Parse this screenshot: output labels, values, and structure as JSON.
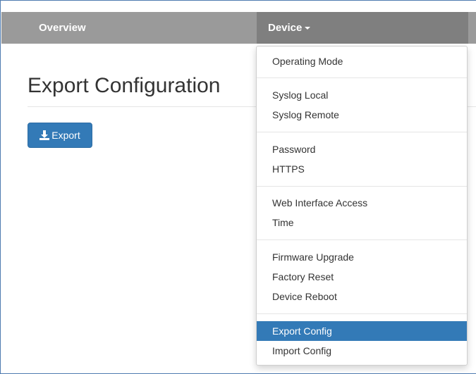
{
  "navbar": {
    "overview_label": "Overview",
    "device_label": "Device"
  },
  "page": {
    "title": "Export Configuration",
    "export_button_label": "Export"
  },
  "device_menu": {
    "items": [
      {
        "label": "Operating Mode",
        "active": false
      },
      {
        "label": "Syslog Local",
        "active": false
      },
      {
        "label": "Syslog Remote",
        "active": false
      },
      {
        "label": "Password",
        "active": false
      },
      {
        "label": "HTTPS",
        "active": false
      },
      {
        "label": "Web Interface Access",
        "active": false
      },
      {
        "label": "Time",
        "active": false
      },
      {
        "label": "Firmware Upgrade",
        "active": false
      },
      {
        "label": "Factory Reset",
        "active": false
      },
      {
        "label": "Device Reboot",
        "active": false
      },
      {
        "label": "Export Config",
        "active": true
      },
      {
        "label": "Import Config",
        "active": false
      }
    ]
  },
  "colors": {
    "navbar": "#9a9a9a",
    "navbar_active": "#7f7f7f",
    "primary": "#337ab7"
  },
  "icons": {
    "export_button_icon": "download-icon",
    "device_caret": "caret-down-icon"
  }
}
